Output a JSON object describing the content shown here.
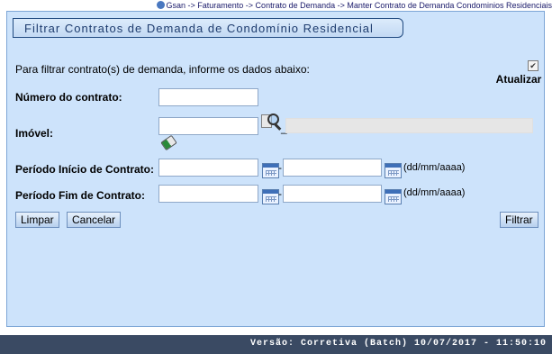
{
  "breadcrumb": "Gsan -> Faturamento -> Contrato de Demanda -> Manter Contrato de Demanda Condominios Residenciais",
  "icons": {
    "home": "gsan-home-icon",
    "search": "magnifier-icon",
    "clear": "eraser-icon",
    "calendar": "calendar-icon"
  },
  "page": {
    "title": "Filtrar Contratos de Demanda de Condomínio Residencial",
    "info": "Para filtrar contrato(s) de demanda, informe os dados abaixo:",
    "atualizar_label": "Atualizar",
    "atualizar_checked": true
  },
  "form": {
    "numero_label": "Número do contrato:",
    "numero_value": "",
    "imovel_label": "Imóvel:",
    "imovel_value": "",
    "imovel_desc": "",
    "inicio_label": "Período Início de Contrato:",
    "inicio_de": "",
    "inicio_ate": "",
    "fim_label": "Período Fim de Contrato:",
    "fim_de": "",
    "fim_ate": "",
    "date_format": "(dd/mm/aaaa)",
    "dash": "-",
    "underscore": "_"
  },
  "buttons": {
    "limpar": "Limpar",
    "cancelar": "Cancelar",
    "filtrar": "Filtrar"
  },
  "footer": "Versão: Corretiva (Batch) 10/07/2017 - 11:50:10",
  "colors": {
    "panel": "#cde3fb",
    "title_text": "#1e3c6e",
    "footer_bg": "#3a4a63"
  }
}
